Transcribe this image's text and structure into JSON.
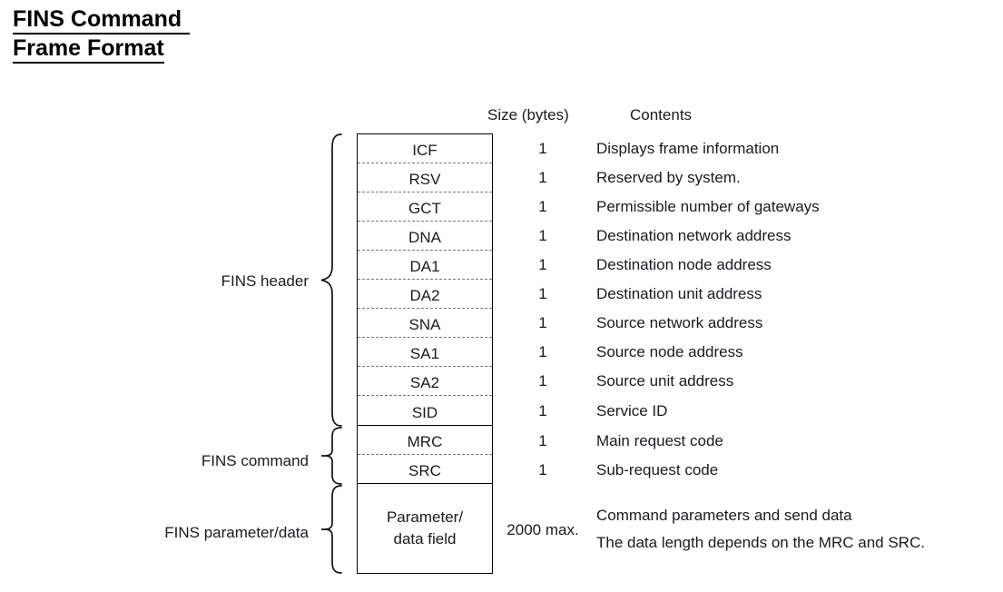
{
  "title": {
    "line1": "FINS Command ",
    "line2": "Frame Format"
  },
  "headers": {
    "size": "Size (bytes)",
    "contents": "Contents"
  },
  "groups": [
    {
      "name": "fins-header",
      "label": "FINS header"
    },
    {
      "name": "fins-command",
      "label": "FINS command"
    },
    {
      "name": "fins-parameter-data",
      "label": "FINS parameter/data"
    }
  ],
  "rows": [
    {
      "field": "ICF",
      "size": "1",
      "contents": "Displays frame information"
    },
    {
      "field": "RSV",
      "size": "1",
      "contents": "Reserved by system."
    },
    {
      "field": "GCT",
      "size": "1",
      "contents": "Permissible number of gateways"
    },
    {
      "field": "DNA",
      "size": "1",
      "contents": "Destination network address"
    },
    {
      "field": "DA1",
      "size": "1",
      "contents": "Destination node address"
    },
    {
      "field": "DA2",
      "size": "1",
      "contents": "Destination unit address"
    },
    {
      "field": "SNA",
      "size": "1",
      "contents": "Source network address"
    },
    {
      "field": "SA1",
      "size": "1",
      "contents": "Source node address"
    },
    {
      "field": "SA2",
      "size": "1",
      "contents": "Source unit address"
    },
    {
      "field": "SID",
      "size": "1",
      "contents": "Service ID"
    },
    {
      "field": "MRC",
      "size": "1",
      "contents": "Main request code"
    },
    {
      "field": "SRC",
      "size": "1",
      "contents": "Sub-request code"
    }
  ],
  "data_row": {
    "field_line1": "Parameter/",
    "field_line2": "data field",
    "size": "2000 max.",
    "contents_line1": "Command parameters and send data",
    "contents_line2": "The data length depends on the MRC and SRC."
  },
  "colors": {
    "text": "#1a1a22",
    "border": "#000000",
    "dashed": "#777777",
    "background": "#ffffff"
  }
}
